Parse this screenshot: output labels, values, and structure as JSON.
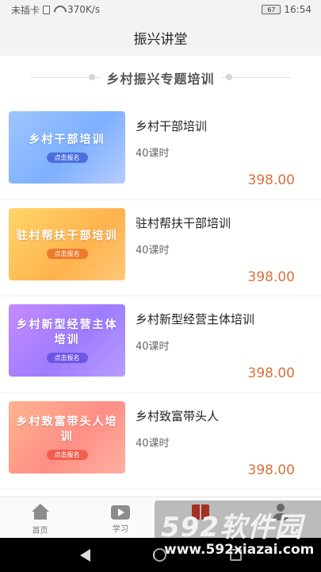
{
  "status_bar": {
    "carrier": "未插卡",
    "speed": "370K/s",
    "battery": "67",
    "time": "16:54"
  },
  "page": {
    "title": "振兴讲堂"
  },
  "section": {
    "title": "乡村振兴专题培训"
  },
  "courses": [
    {
      "thumb_title": "乡村干部培训",
      "thumb_button": "点击报名",
      "name": "乡村干部培训",
      "hours": "40课时",
      "price": "398.00"
    },
    {
      "thumb_title": "驻村帮扶干部培训",
      "thumb_button": "点击报名",
      "name": "驻村帮扶干部培训",
      "hours": "40课时",
      "price": "398.00"
    },
    {
      "thumb_title": "乡村新型经营主体培训",
      "thumb_button": "点击报名",
      "name": "乡村新型经营主体培训",
      "hours": "40课时",
      "price": "398.00"
    },
    {
      "thumb_title": "乡村致富带头人培训",
      "thumb_button": "点击报名",
      "name": "乡村致富带头人",
      "hours": "40课时",
      "price": "398.00"
    }
  ],
  "tabs": [
    {
      "label": "首页",
      "icon": "home-icon"
    },
    {
      "label": "学习",
      "icon": "play-icon"
    },
    {
      "label": "",
      "icon": "book-icon"
    },
    {
      "label": "",
      "icon": "person-icon"
    }
  ],
  "colors": {
    "price": "#d9703f",
    "active_tab": "#d9422c"
  },
  "watermark": {
    "text": "592软件园",
    "url": "www.592xiazai.com"
  }
}
